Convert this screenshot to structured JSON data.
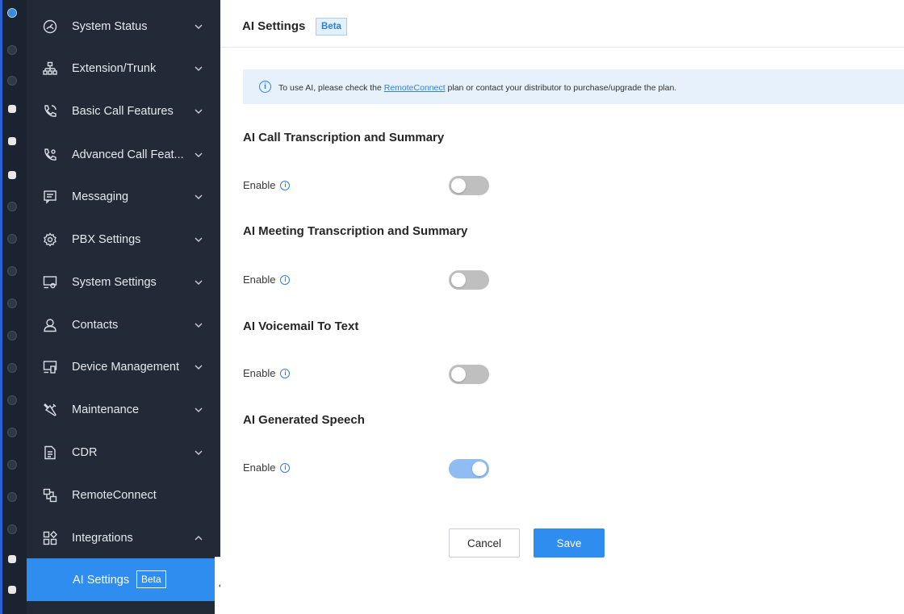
{
  "sidebar": {
    "items": [
      {
        "label": "System Status",
        "icon": "gauge-icon",
        "expanded": false
      },
      {
        "label": "Extension/Trunk",
        "icon": "org-chart-icon",
        "expanded": false
      },
      {
        "label": "Basic Call Features",
        "icon": "phone-icon",
        "expanded": false
      },
      {
        "label": "Advanced Call Feat...",
        "icon": "phone-settings-icon",
        "expanded": false
      },
      {
        "label": "Messaging",
        "icon": "message-icon",
        "expanded": false
      },
      {
        "label": "PBX Settings",
        "icon": "gear-icon",
        "expanded": false
      },
      {
        "label": "System Settings",
        "icon": "monitor-gear-icon",
        "expanded": false
      },
      {
        "label": "Contacts",
        "icon": "person-icon",
        "expanded": false
      },
      {
        "label": "Device Management",
        "icon": "devices-icon",
        "expanded": false
      },
      {
        "label": "Maintenance",
        "icon": "tools-icon",
        "expanded": false
      },
      {
        "label": "CDR",
        "icon": "document-icon",
        "expanded": false
      },
      {
        "label": "RemoteConnect",
        "icon": "remote-connect-icon",
        "expanded": null
      },
      {
        "label": "Integrations",
        "icon": "apps-icon",
        "expanded": true
      }
    ],
    "active_item": {
      "label": "AI Settings",
      "badge": "Beta"
    }
  },
  "header": {
    "title": "AI Settings",
    "badge": "Beta"
  },
  "notice": {
    "prefix": "To use AI, please check the ",
    "link": "RemoteConnect",
    "suffix": " plan or contact your distributor to purchase/upgrade the plan."
  },
  "sections": [
    {
      "title": "AI Call Transcription and Summary",
      "enable_label": "Enable",
      "enabled": false
    },
    {
      "title": "AI Meeting Transcription and Summary",
      "enable_label": "Enable",
      "enabled": false
    },
    {
      "title": "AI Voicemail To Text",
      "enable_label": "Enable",
      "enabled": false
    },
    {
      "title": "AI Generated Speech",
      "enable_label": "Enable",
      "enabled": true
    }
  ],
  "buttons": {
    "cancel": "Cancel",
    "save": "Save"
  },
  "colors": {
    "accent": "#2f8df0",
    "sidebar_bg": "#212a36",
    "toggle_on": "#8fbdf3",
    "toggle_off": "#bfbfbf"
  }
}
